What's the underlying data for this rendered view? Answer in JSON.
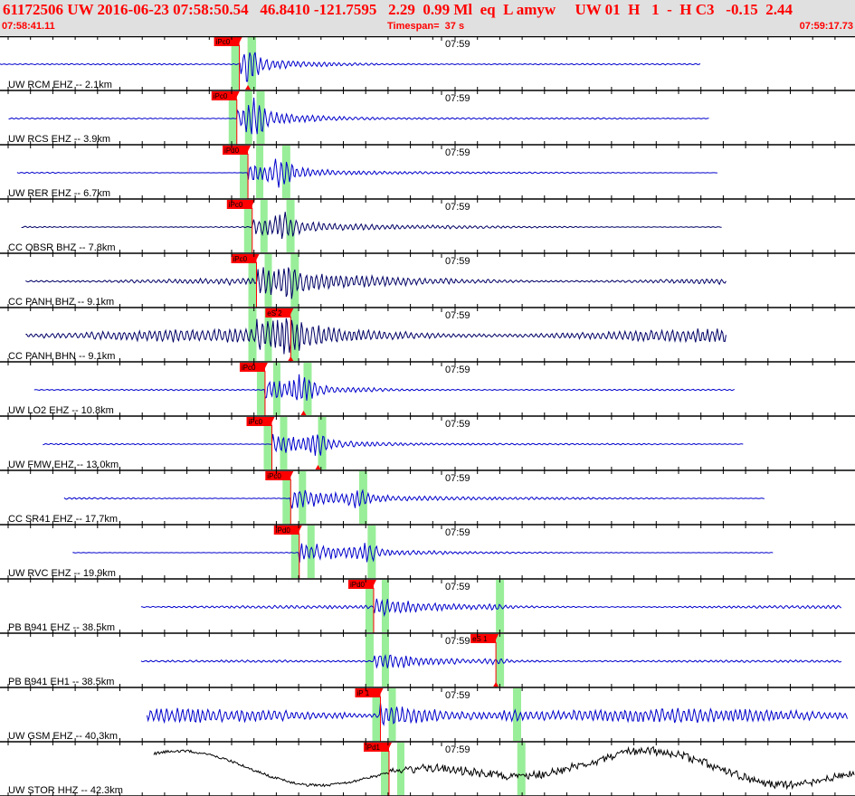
{
  "header": {
    "title": "61172506 UW 2016-06-23 07:58:50.54   46.8410 -121.7595   2.29  0.99 Ml  eq  L amyw     UW 01  H   1  -  H C3   -0.15  2.44",
    "start_time": "07:58:41.11",
    "timespan": "Timespan=  37 s",
    "end_time": "07:59:17.73"
  },
  "colors": {
    "accent": "#ff0000",
    "pick": "#ff0000",
    "window": "#99ee99",
    "header_bg": "#e0e0e0"
  },
  "traces": [
    {
      "label": "UW RCM EHZ -- 2.1km",
      "minute": "07:59",
      "picks": [
        "iPc0"
      ],
      "color": "#0000cc",
      "start": 0.0,
      "end": 0.82,
      "p": 0.28,
      "s": 0.29,
      "amp": 0.35,
      "noise": 0.03,
      "pkind": "first",
      "s_marker": true
    },
    {
      "label": "UW RCS EHZ -- 3.9km",
      "minute": "07:59",
      "picks": [
        "iPc0"
      ],
      "color": "#0000cc",
      "start": 0.01,
      "end": 0.83,
      "p": 0.277,
      "s": 0.3,
      "amp": 0.45,
      "noise": 0.03,
      "pkind": "first",
      "s_marker": false
    },
    {
      "label": "UW RER EHZ -- 6.7km",
      "minute": "07:59",
      "picks": [
        "iPd0"
      ],
      "color": "#0000cc",
      "start": 0.02,
      "end": 0.84,
      "p": 0.29,
      "s": 0.33,
      "amp": 0.45,
      "noise": 0.03,
      "pkind": "first",
      "s_marker": false
    },
    {
      "label": "CC OBSR BHZ -- 7.8km",
      "minute": "07:59",
      "picks": [
        "iPc0"
      ],
      "color": "#000066",
      "start": 0.025,
      "end": 0.845,
      "p": 0.295,
      "s": 0.335,
      "amp": 0.4,
      "noise": 0.06,
      "pkind": "first",
      "s_marker": false
    },
    {
      "label": "CC PANH BHZ -- 9.1km",
      "minute": "07:59",
      "picks": [
        "iPc0"
      ],
      "color": "#000066",
      "start": 0.03,
      "end": 0.85,
      "p": 0.3,
      "s": 0.34,
      "amp": 0.45,
      "noise": 0.18,
      "pkind": "first",
      "s_marker": false
    },
    {
      "label": "CC PANH BHN -- 9.1km",
      "minute": "07:59",
      "picks": [
        "eS 2"
      ],
      "color": "#000066",
      "start": 0.03,
      "end": 0.85,
      "p": 0.3,
      "s": 0.34,
      "amp": 0.5,
      "noise": 0.3,
      "pkind": "second",
      "s_marker": true
    },
    {
      "label": "UW LO2 EHZ -- 10.8km",
      "minute": "07:59",
      "picks": [
        "iPc0"
      ],
      "color": "#0000cc",
      "start": 0.04,
      "end": 0.86,
      "p": 0.31,
      "s": 0.355,
      "amp": 0.45,
      "noise": 0.03,
      "pkind": "first",
      "s_marker": true
    },
    {
      "label": "UW FMW EHZ -- 13.0km",
      "minute": "07:59",
      "picks": [
        "iPc0"
      ],
      "color": "#0000cc",
      "start": 0.05,
      "end": 0.87,
      "p": 0.318,
      "s": 0.372,
      "amp": 0.45,
      "noise": 0.03,
      "pkind": "first",
      "s_marker": true
    },
    {
      "label": "CC SR41 EHZ -- 17.7km",
      "minute": "07:59",
      "picks": [
        "iPc0"
      ],
      "color": "#0000cc",
      "start": 0.075,
      "end": 0.895,
      "p": 0.34,
      "s": 0.42,
      "amp": 0.45,
      "noise": 0.05,
      "pkind": "first",
      "s_marker": false
    },
    {
      "label": "UW RVC EHZ -- 19.9km",
      "minute": "07:59",
      "picks": [
        "iPd0"
      ],
      "color": "#0000cc",
      "start": 0.085,
      "end": 0.905,
      "p": 0.35,
      "s": 0.43,
      "amp": 0.45,
      "noise": 0.03,
      "pkind": "first",
      "s_marker": false
    },
    {
      "label": "PB B941 EHZ -- 38.5km",
      "minute": "07:59",
      "picks": [
        "iPd0"
      ],
      "color": "#0000cc",
      "start": 0.165,
      "end": 0.985,
      "p": 0.437,
      "s": 0.58,
      "amp": 0.35,
      "noise": 0.07,
      "pkind": "first",
      "s_marker": false
    },
    {
      "label": "PB B941 EH1 -- 38.5km",
      "minute": "07:59",
      "picks": [
        "eS 1"
      ],
      "color": "#0000cc",
      "start": 0.165,
      "end": 0.985,
      "p": 0.437,
      "s": 0.58,
      "amp": 0.4,
      "noise": 0.05,
      "pkind": "second",
      "s_marker": true
    },
    {
      "label": "UW GSM EHZ -- 40.3km",
      "minute": "07:59",
      "picks": [
        "iP 1"
      ],
      "color": "#0000cc",
      "start": 0.172,
      "end": 0.992,
      "p": 0.445,
      "s": 0.6,
      "amp": 0.45,
      "noise": 0.3,
      "pkind": "first",
      "s_marker": false
    },
    {
      "label": "UW STOR HHZ -- 42.3km",
      "minute": "07:59",
      "picks": [
        "iPd1"
      ],
      "color": "#000000",
      "start": 0.18,
      "end": 1.0,
      "p": 0.455,
      "s": 0.605,
      "amp": 0.25,
      "noise": 0.02,
      "pkind": "first",
      "s_marker": false
    }
  ]
}
